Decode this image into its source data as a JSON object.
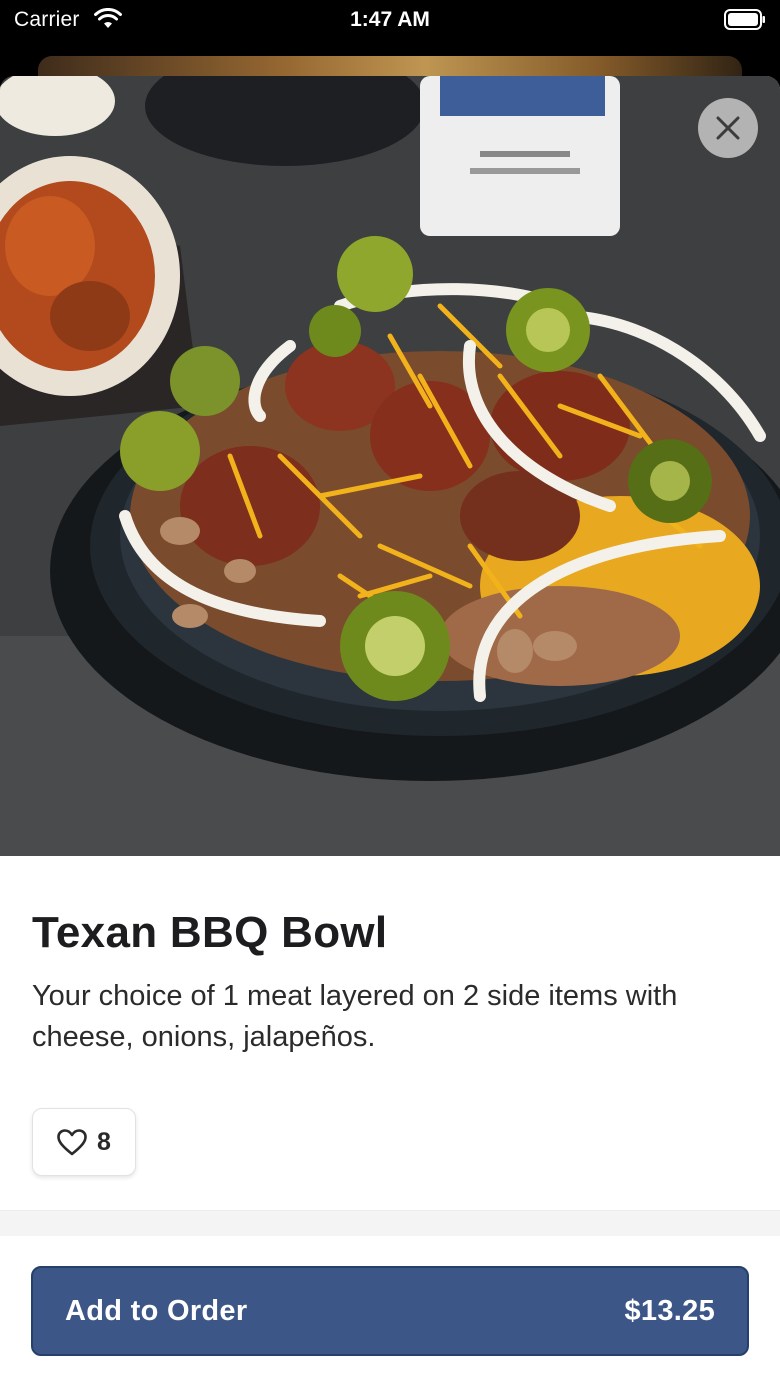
{
  "status_bar": {
    "carrier": "Carrier",
    "time": "1:47 AM"
  },
  "item": {
    "title": "Texan BBQ Bowl",
    "description": "Your choice of 1 meat layered on 2 side items with cheese, onions, jalapeños.",
    "like_count": "8",
    "image_alt": "Texan BBQ Bowl photo"
  },
  "actions": {
    "add_to_order_label": "Add to Order",
    "price": "$13.25"
  },
  "icons": {
    "close": "close-icon",
    "like": "heart-outline-icon",
    "wifi": "wifi-icon",
    "battery": "battery-icon"
  },
  "colors": {
    "primary_button": "#3b5687",
    "close_button_bg": "#c8c8c8"
  }
}
